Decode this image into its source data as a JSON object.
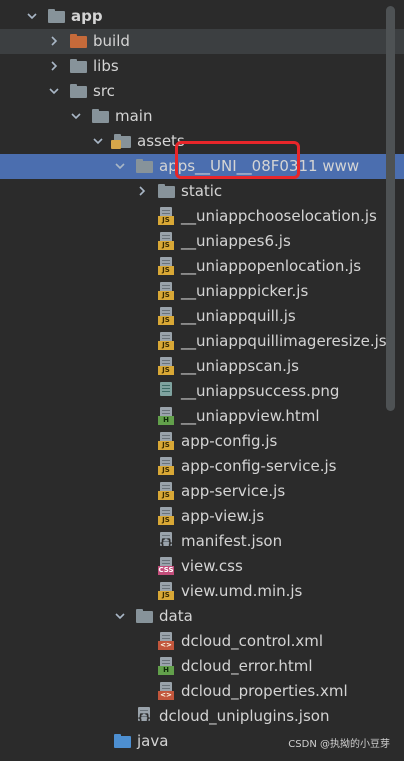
{
  "tree": {
    "items": [
      {
        "label": "app",
        "kind": "folder",
        "folder_color": "gray",
        "expanded": true,
        "bold": true,
        "depth": 0
      },
      {
        "label": "build",
        "kind": "folder",
        "folder_color": "orange",
        "expanded": false,
        "depth": 1
      },
      {
        "label": "libs",
        "kind": "folder",
        "folder_color": "gray",
        "expanded": false,
        "depth": 1
      },
      {
        "label": "src",
        "kind": "folder",
        "folder_color": "gray",
        "expanded": true,
        "depth": 1
      },
      {
        "label": "main",
        "kind": "folder",
        "folder_color": "gray",
        "expanded": true,
        "depth": 2
      },
      {
        "label": "assets",
        "kind": "folder",
        "folder_color": "assets",
        "expanded": true,
        "depth": 3
      },
      {
        "label": "apps__UNI__08F0311 www",
        "kind": "folder",
        "folder_color": "gray",
        "expanded": true,
        "selected": true,
        "depth": 4
      },
      {
        "label": "static",
        "kind": "folder",
        "folder_color": "gray",
        "expanded": false,
        "depth": 5
      },
      {
        "label": "__uniappchooselocation.js",
        "kind": "file",
        "file_type": "js",
        "depth": 5
      },
      {
        "label": "__uniappes6.js",
        "kind": "file",
        "file_type": "js",
        "depth": 5
      },
      {
        "label": "__uniappopenlocation.js",
        "kind": "file",
        "file_type": "js",
        "depth": 5
      },
      {
        "label": "__uniapppicker.js",
        "kind": "file",
        "file_type": "js",
        "depth": 5
      },
      {
        "label": "__uniappquill.js",
        "kind": "file",
        "file_type": "js",
        "depth": 5
      },
      {
        "label": "__uniappquillimageresize.js",
        "kind": "file",
        "file_type": "js",
        "depth": 5
      },
      {
        "label": "__uniappscan.js",
        "kind": "file",
        "file_type": "js",
        "depth": 5
      },
      {
        "label": "__uniappsuccess.png",
        "kind": "file",
        "file_type": "png",
        "depth": 5
      },
      {
        "label": "__uniappview.html",
        "kind": "file",
        "file_type": "html",
        "depth": 5
      },
      {
        "label": "app-config.js",
        "kind": "file",
        "file_type": "js",
        "depth": 5
      },
      {
        "label": "app-config-service.js",
        "kind": "file",
        "file_type": "js",
        "depth": 5
      },
      {
        "label": "app-service.js",
        "kind": "file",
        "file_type": "js",
        "depth": 5
      },
      {
        "label": "app-view.js",
        "kind": "file",
        "file_type": "js",
        "depth": 5
      },
      {
        "label": "manifest.json",
        "kind": "file",
        "file_type": "json",
        "depth": 5
      },
      {
        "label": "view.css",
        "kind": "file",
        "file_type": "css",
        "depth": 5
      },
      {
        "label": "view.umd.min.js",
        "kind": "file",
        "file_type": "js",
        "depth": 5
      },
      {
        "label": "data",
        "kind": "folder",
        "folder_color": "gray",
        "expanded": true,
        "depth": 4
      },
      {
        "label": "dcloud_control.xml",
        "kind": "file",
        "file_type": "xml",
        "depth": 5
      },
      {
        "label": "dcloud_error.html",
        "kind": "file",
        "file_type": "html",
        "depth": 5
      },
      {
        "label": "dcloud_properties.xml",
        "kind": "file",
        "file_type": "xml",
        "depth": 5
      },
      {
        "label": "dcloud_uniplugins.json",
        "kind": "file",
        "file_type": "json",
        "depth": 4
      },
      {
        "label": "java",
        "kind": "folder",
        "folder_color": "blue",
        "expanded": false,
        "no_arrow": true,
        "depth": 3
      }
    ]
  },
  "tag_text": {
    "js": "JS",
    "html": "H",
    "css": "CSS",
    "xml": "<>",
    "json": "{}"
  },
  "watermark": "CSDN @执拗的小豆芽",
  "colors": {
    "selection": "#4b6eaf",
    "highlight_box": "#e8262a",
    "panel_bg": "#2b2b2b"
  }
}
